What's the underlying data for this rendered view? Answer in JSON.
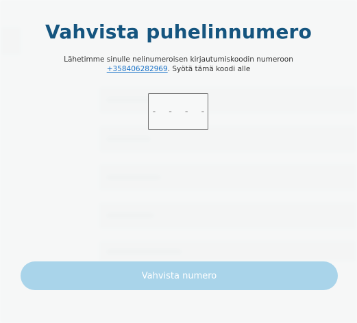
{
  "modal": {
    "title": "Vahvista puhelinnumero",
    "description_prefix": "Lähetimme sinulle nelinumeroisen kirjautumiskoodin numeroon",
    "phone_number": "+358406282969",
    "description_suffix": ". Syötä tämä koodi alle",
    "code_placeholder": "- - - -",
    "code_value": "",
    "verify_button_label": "Vahvista numero"
  },
  "colors": {
    "title": "#15557f",
    "link": "#1a73c8",
    "button": "#a9d4ea",
    "button_text": "#ffffff"
  }
}
